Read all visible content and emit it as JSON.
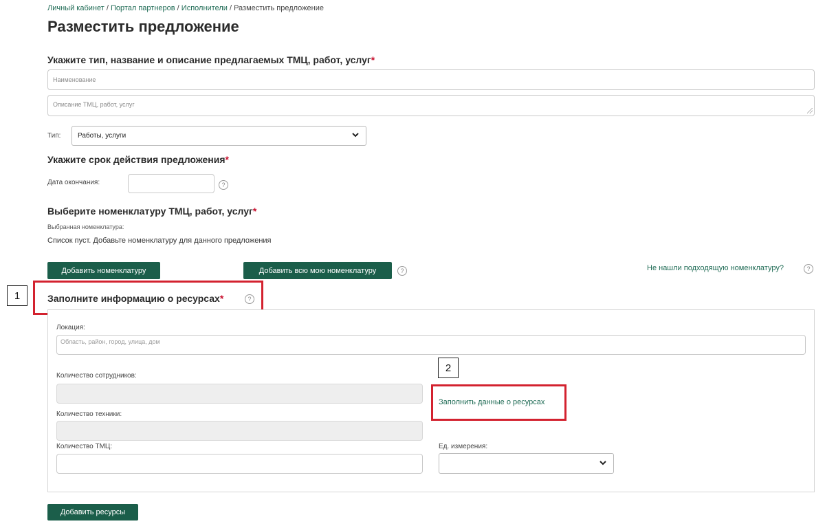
{
  "breadcrumb": {
    "items": [
      "Личный кабинет",
      "Портал партнеров",
      "Исполнители"
    ],
    "current": "Разместить предложение",
    "separator": " / "
  },
  "page_title": "Разместить предложение",
  "section_offer": {
    "heading": "Укажите тип, название и описание предлагаемых ТМЦ, работ, услуг",
    "required_mark": "*",
    "name_placeholder": "Наименование",
    "description_placeholder": "Описание ТМЦ, работ, услуг",
    "type_label": "Тип:",
    "type_value": "Работы, услуги"
  },
  "section_validity": {
    "heading": "Укажите срок действия предложения",
    "required_mark": "*",
    "end_date_label": "Дата окончания:",
    "end_date_value": "",
    "help_icon": "question-circle-icon"
  },
  "section_nomenclature": {
    "heading": "Выберите номенклатуру ТМЦ, работ, услуг",
    "required_mark": "*",
    "selected_label": "Выбранная номенклатура:",
    "empty_text": "Список пуст. Добавьте номенклатуру для данного предложения",
    "add_button": "Добавить номенклатуру",
    "add_all_button": "Добавить всю мою номенклатуру",
    "not_found_link": "Не нашли подходящую номенклатуру?"
  },
  "section_resources": {
    "heading": "Заполните информацию о ресурсах",
    "required_mark": "*",
    "location_label": "Локация:",
    "location_placeholder": "Область, район, город, улица, дом",
    "employees_label": "Количество сотрудников:",
    "equipment_label": "Количество техники:",
    "tmc_label": "Количество ТМЦ:",
    "unit_label": "Ед. измерения:",
    "unit_value": "",
    "fill_link": "Заполнить данные о ресурсах",
    "add_resources_button": "Добавить ресурсы"
  },
  "annotations": {
    "marker_1": "1",
    "marker_2": "2"
  },
  "colors": {
    "brand_green": "#1b5e4a",
    "link_green": "#1f6b55",
    "required_red": "#c8102e",
    "annotation_red": "#d3222f"
  }
}
